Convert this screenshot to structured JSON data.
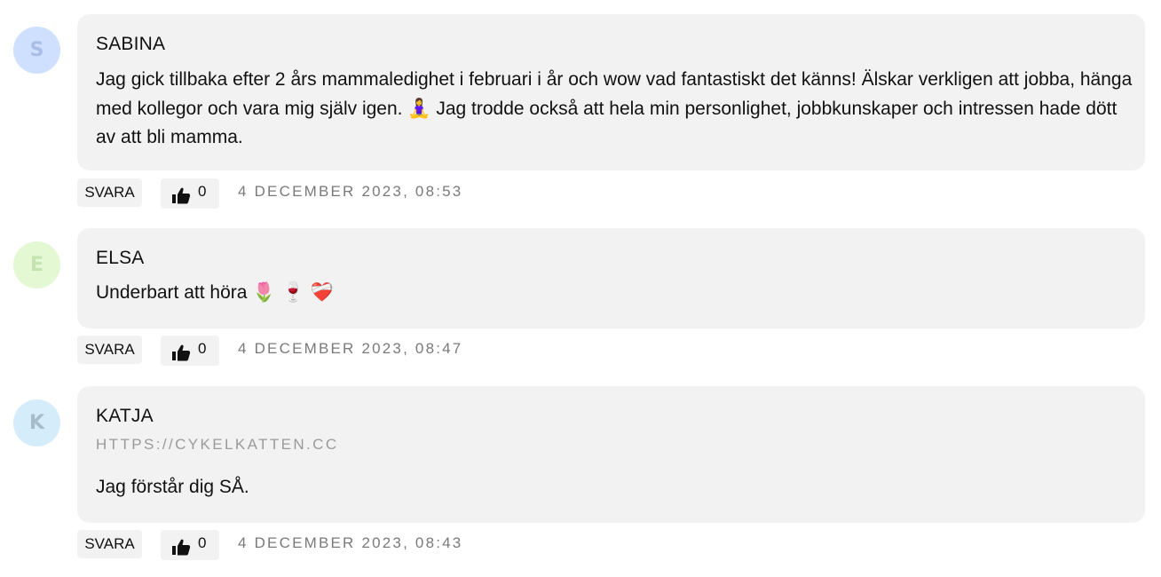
{
  "comments": [
    {
      "initial": "S",
      "avatar_bg": "#cfe0ff",
      "avatar_fg": "#a9bee6",
      "author": "SABINA",
      "text_line1": "Jag gick tillbaka efter 2 års mammaledighet i februari i år och wow vad fantastiskt det känns! Älskar verkligen att jobba, hänga",
      "text_line2a": "med kollegor och vara mig själv igen. ",
      "emoji_a": "🧘‍♀️",
      "text_line2b": " Jag trodde också att hela min personlighet, jobbkunskaper och intressen hade dött",
      "text_line3": "av att bli mamma.",
      "reply_label": "SVARA",
      "like_count": "0",
      "timestamp": "4 DECEMBER 2023, 08:53"
    },
    {
      "initial": "E",
      "avatar_bg": "#e3f8d3",
      "avatar_fg": "#c5e3b0",
      "author": "ELSA",
      "text": "Underbart att höra ",
      "emojis": "🌷 🍷 ❤️‍🩹",
      "reply_label": "SVARA",
      "like_count": "0",
      "timestamp": "4 DECEMBER 2023, 08:47"
    },
    {
      "initial": "K",
      "avatar_bg": "#d5ecfb",
      "avatar_fg": "#a6bccb",
      "author": "KATJA",
      "website": "HTTPS://CYKELKATTEN.CC",
      "text": "Jag förstår dig SÅ.",
      "reply_label": "SVARA",
      "like_count": "0",
      "timestamp": "4 DECEMBER 2023, 08:43"
    }
  ],
  "icons": {
    "like": "thumbs-up-icon"
  }
}
